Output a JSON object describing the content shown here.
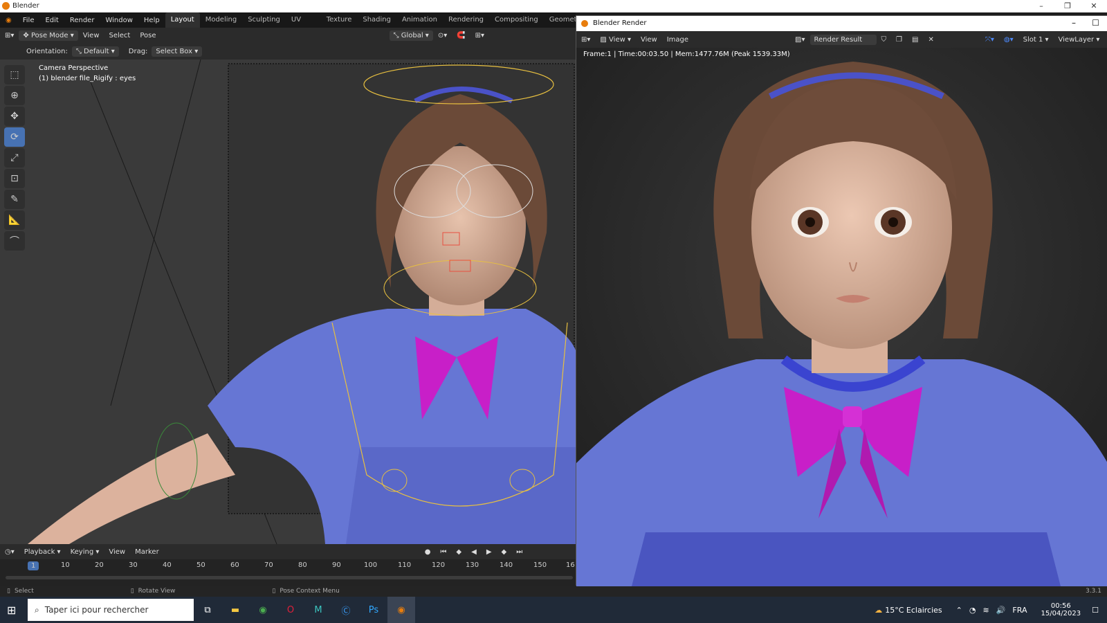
{
  "app_title": "Blender",
  "menu": [
    "File",
    "Edit",
    "Render",
    "Window",
    "Help"
  ],
  "workspaces": [
    "Layout",
    "Modeling",
    "Sculpting",
    "UV Editing",
    "Texture Paint",
    "Shading",
    "Animation",
    "Rendering",
    "Compositing",
    "Geometry Nodes"
  ],
  "header": {
    "mode": "Pose Mode",
    "view": "View",
    "select": "Select",
    "pose": "Pose",
    "transform": "Global"
  },
  "header2": {
    "orientation_label": "Orientation:",
    "orientation_value": "Default",
    "drag_label": "Drag:",
    "drag_value": "Select Box"
  },
  "viewport": {
    "camera": "Camera Perspective",
    "object": "(1) blender file_Rigify : eyes"
  },
  "timeline": {
    "playback": "Playback",
    "keying": "Keying",
    "view": "View",
    "marker": "Marker",
    "current_frame": "1",
    "ticks": [
      "10",
      "20",
      "30",
      "40",
      "50",
      "60",
      "70",
      "80",
      "90",
      "100",
      "110",
      "120",
      "130",
      "140",
      "150",
      "16"
    ]
  },
  "status": {
    "select": "Select",
    "rotate": "Rotate View",
    "context": "Pose Context Menu",
    "version": "3.3.1"
  },
  "render_window": {
    "title": "Blender Render",
    "view": "View",
    "view2": "View",
    "image": "Image",
    "result": "Render Result",
    "slot": "Slot 1",
    "viewlayer": "ViewLayer",
    "info": "Frame:1 | Time:00:03.50 | Mem:1477.76M (Peak 1539.33M)"
  },
  "taskbar": {
    "search": "Taper ici pour rechercher",
    "weather": "15°C  Eclaircies",
    "lang": "FRA",
    "time": "00:56",
    "date": "15/04/2023"
  },
  "colors": {
    "accent": "#4772b3",
    "dress": "#5b6fd6",
    "bow": "#c81fc8"
  }
}
